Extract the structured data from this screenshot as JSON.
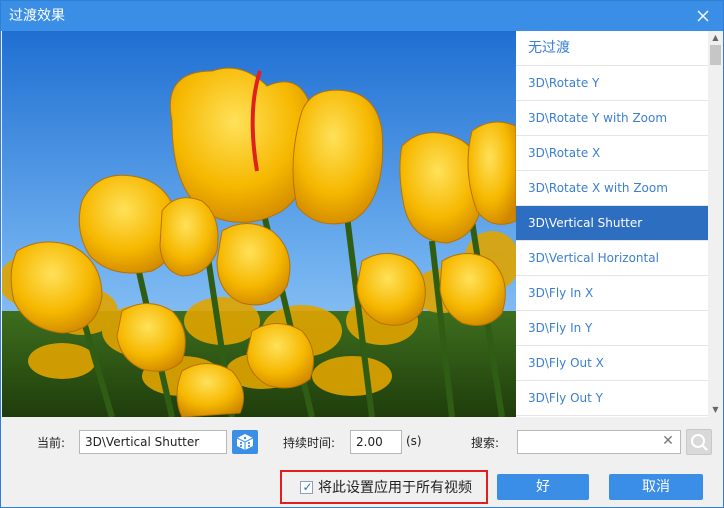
{
  "window": {
    "title": "过渡效果"
  },
  "transitions": {
    "items": [
      {
        "label": "无过渡"
      },
      {
        "label": "3D\\Rotate Y"
      },
      {
        "label": "3D\\Rotate Y with Zoom"
      },
      {
        "label": "3D\\Rotate X"
      },
      {
        "label": "3D\\Rotate X with Zoom"
      },
      {
        "label": "3D\\Vertical Shutter"
      },
      {
        "label": "3D\\Vertical Horizontal"
      },
      {
        "label": "3D\\Fly In X"
      },
      {
        "label": "3D\\Fly In Y"
      },
      {
        "label": "3D\\Fly Out X"
      },
      {
        "label": "3D\\Fly Out Y"
      }
    ],
    "selected": "3D\\Vertical Shutter"
  },
  "controls": {
    "current_label": "当前:",
    "current_value": "3D\\Vertical Shutter",
    "duration_label": "持续时间:",
    "duration_value": "2.00",
    "duration_unit": "(s)",
    "search_label": "搜索:",
    "search_value": ""
  },
  "footer": {
    "apply_all_label": "将此设置应用于所有视频",
    "apply_all_checked": true,
    "ok_label": "好",
    "cancel_label": "取消"
  },
  "icons": {
    "close": "close-icon",
    "dice": "random-dice-icon",
    "search": "search-icon",
    "clear": "clear-icon"
  },
  "colors": {
    "title_bar": "#3a8ee6",
    "selected_item": "#2d6ec0",
    "item_text": "#3a7fd0",
    "highlight_border": "#e0201f"
  }
}
